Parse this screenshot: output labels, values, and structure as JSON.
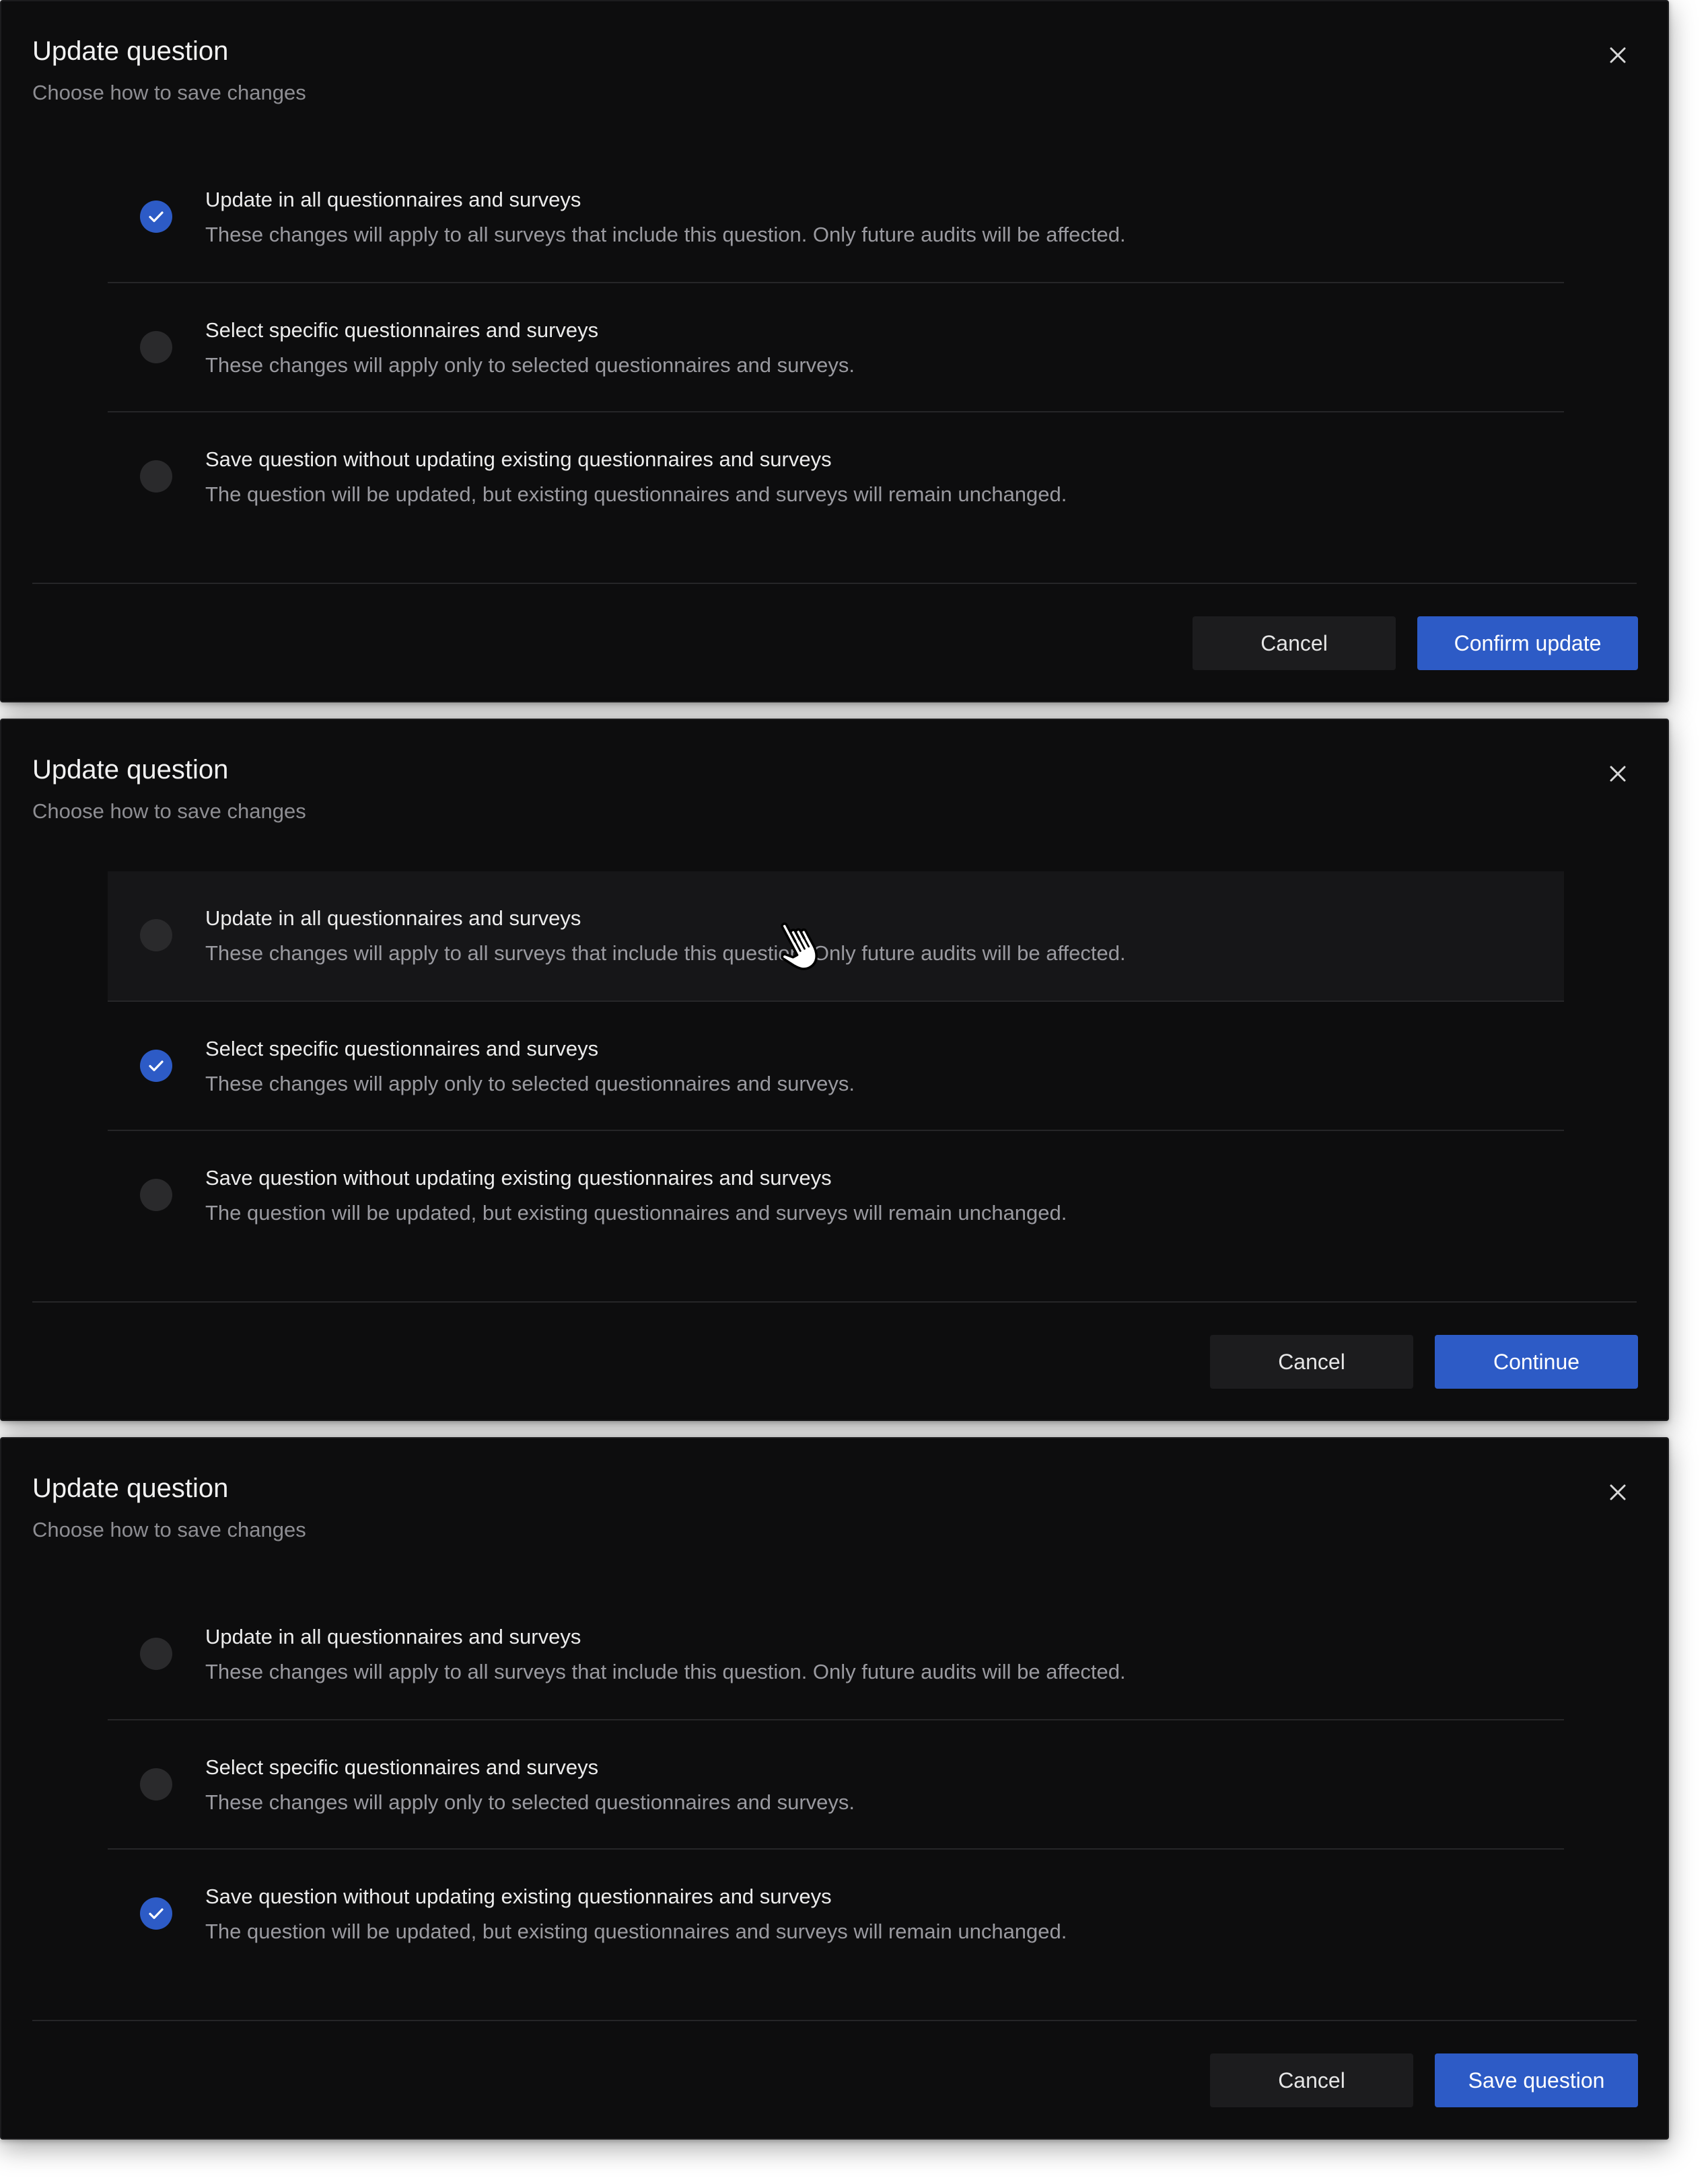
{
  "colors": {
    "dialog_bg": "#0d0d0e",
    "accent": "#2d5bc6",
    "radio_unchecked": "#2a2a2c",
    "divider": "#262628",
    "cancel_bg": "#1c1c1e"
  },
  "icons": {
    "close": "close-icon",
    "check": "check-icon",
    "cursor": "hand-pointer-icon"
  },
  "dialogs": [
    {
      "title": "Update question",
      "subtitle": "Choose how to save changes",
      "selected_option": 0,
      "options": [
        {
          "title": "Update in all questionnaires and surveys",
          "description": "These changes will apply to all surveys that include this question. Only future audits will be affected."
        },
        {
          "title": "Select specific questionnaires and surveys",
          "description": "These changes will apply only to selected questionnaires and surveys."
        },
        {
          "title": "Save question without updating existing questionnaires and surveys",
          "description": "The question will be updated, but existing questionnaires and surveys will remain unchanged."
        }
      ],
      "cancel_label": "Cancel",
      "primary_label": "Confirm update"
    },
    {
      "title": "Update question",
      "subtitle": "Choose how to save changes",
      "selected_option": 1,
      "hovered_option": 0,
      "options": [
        {
          "title": "Update in all questionnaires and surveys",
          "description": "These changes will apply to all surveys that include this question. Only future audits will be affected."
        },
        {
          "title": "Select specific questionnaires and surveys",
          "description": "These changes will apply only to selected questionnaires and surveys."
        },
        {
          "title": "Save question without updating existing questionnaires and surveys",
          "description": "The question will be updated, but existing questionnaires and surveys will remain unchanged."
        }
      ],
      "cancel_label": "Cancel",
      "primary_label": "Continue"
    },
    {
      "title": "Update question",
      "subtitle": "Choose how to save changes",
      "selected_option": 2,
      "options": [
        {
          "title": "Update in all questionnaires and surveys",
          "description": "These changes will apply to all surveys that include this question. Only future audits will be affected."
        },
        {
          "title": "Select specific questionnaires and surveys",
          "description": "These changes will apply only to selected questionnaires and surveys."
        },
        {
          "title": "Save question without updating existing questionnaires and surveys",
          "description": "The question will be updated, but existing questionnaires and surveys will remain unchanged."
        }
      ],
      "cancel_label": "Cancel",
      "primary_label": "Save question"
    }
  ]
}
